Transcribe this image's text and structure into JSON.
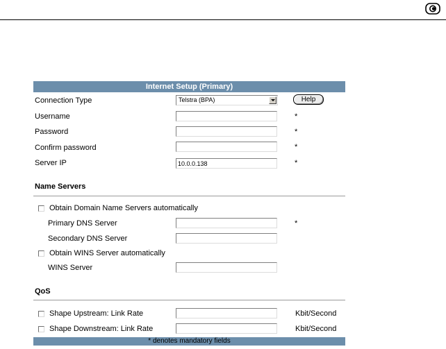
{
  "panel": {
    "title": "Internet Setup (Primary)",
    "footer": "* denotes mandatory fields"
  },
  "connection": {
    "label": "Connection Type",
    "selected": "Telstra (BPA)",
    "help_label": "Help"
  },
  "fields": {
    "username": {
      "label": "Username",
      "value": "",
      "mandatory": "*"
    },
    "password": {
      "label": "Password",
      "value": "",
      "mandatory": "*"
    },
    "confirm_password": {
      "label": "Confirm password",
      "value": "",
      "mandatory": "*"
    },
    "server_ip": {
      "label": "Server IP",
      "value": "10.0.0.138",
      "mandatory": "*"
    }
  },
  "name_servers": {
    "heading": "Name Servers",
    "auto_dns_label": "Obtain Domain Name Servers automatically",
    "auto_dns_checked": false,
    "primary_dns": {
      "label": "Primary DNS Server",
      "value": "",
      "mandatory": "*"
    },
    "secondary_dns": {
      "label": "Secondary DNS Server",
      "value": ""
    },
    "auto_wins_label": "Obtain WINS Server automatically",
    "auto_wins_checked": false,
    "wins_server": {
      "label": "WINS Server",
      "value": ""
    }
  },
  "qos": {
    "heading": "QoS",
    "upstream": {
      "label": "Shape Upstream: Link Rate",
      "checked": false,
      "value": "",
      "unit": "Kbit/Second"
    },
    "downstream": {
      "label": "Shape Downstream: Link Rate",
      "checked": false,
      "value": "",
      "unit": "Kbit/Second"
    }
  },
  "icons": {
    "logo": "toggle-logo-icon",
    "select_arrow": "chevron-down-icon"
  }
}
